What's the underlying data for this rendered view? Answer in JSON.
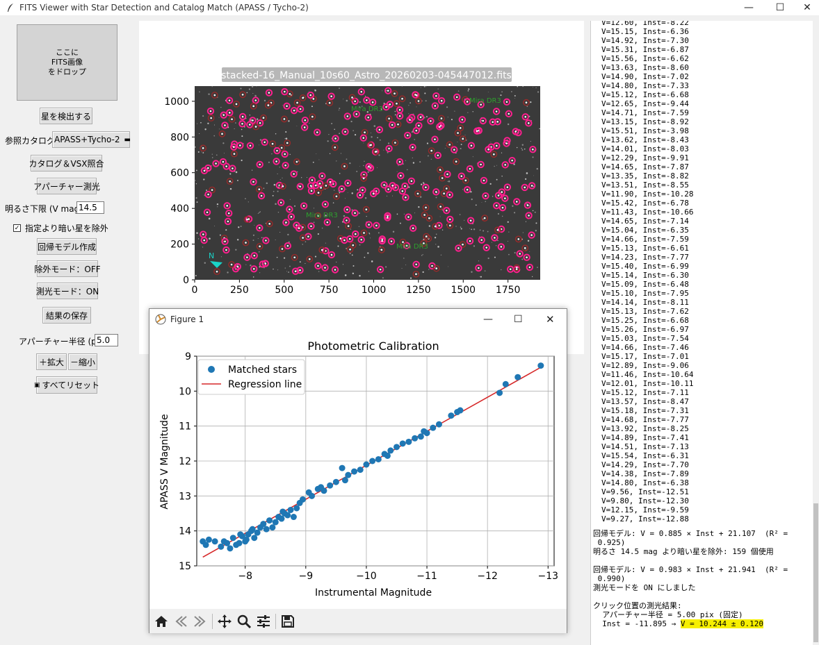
{
  "window": {
    "title": "FITS Viewer with Star Detection and Catalog Match (APASS / Tycho-2)",
    "min": "—",
    "max": "☐",
    "close": "✕"
  },
  "left": {
    "dropzone": [
      "ここに",
      "FITS画像",
      "をドロップ"
    ],
    "detect": "星を検出する",
    "catalog_label": "参照カタログ:",
    "catalog_value": "APASS+Tycho-2",
    "match": "カタログ＆VSX照合",
    "aperture_btn": "アパーチャー測光",
    "mag_label": "明るさ下限 (V mag):",
    "mag_value": "14.5",
    "exclude_faint": "指定より暗い星を除外",
    "regression": "回帰モデル作成",
    "exclude_mode": "除外モード：OFF",
    "phot_mode": "測光モード：ON",
    "save": "結果の保存",
    "radius_label": "アパーチャー半径 (pix):",
    "radius_value": "5.0",
    "zoom_in": "＋拡大",
    "zoom_out": "－縮小",
    "reset": "すべてリセット"
  },
  "image": {
    "filename": "stacked-16_Manual_10s60_Astro_20260203-045447012.fits",
    "xticks": [
      "0",
      "250",
      "500",
      "750",
      "1000",
      "1250",
      "1500",
      "1750"
    ],
    "yticks": [
      "0",
      "200",
      "400",
      "600",
      "800",
      "1000"
    ],
    "labels": [
      "Mira DR3",
      "Mira DR3",
      "Mira DR3",
      "Mira DR3"
    ],
    "north": "N"
  },
  "figure": {
    "window_title": "Figure 1",
    "legend_points": "Matched stars",
    "legend_line": "Regression line"
  },
  "chart_data": {
    "type": "scatter",
    "title": "Photometric Calibration",
    "xlabel": "Instrumental Magnitude",
    "ylabel": "APASS V Magnitude",
    "xlim": [
      -7.2,
      -13.1
    ],
    "ylim": [
      15,
      9
    ],
    "xticks": [
      -8,
      -9,
      -10,
      -11,
      -12,
      -13
    ],
    "yticks": [
      9,
      10,
      11,
      12,
      13,
      14,
      15
    ],
    "series": [
      {
        "name": "Matched stars",
        "color": "#1f77b4",
        "points": [
          [
            -7.3,
            14.3
          ],
          [
            -7.35,
            14.4
          ],
          [
            -7.4,
            14.25
          ],
          [
            -7.5,
            14.3
          ],
          [
            -7.6,
            14.45
          ],
          [
            -7.65,
            14.3
          ],
          [
            -7.7,
            14.35
          ],
          [
            -7.75,
            14.5
          ],
          [
            -7.8,
            14.2
          ],
          [
            -7.85,
            14.4
          ],
          [
            -7.9,
            14.35
          ],
          [
            -7.95,
            14.15
          ],
          [
            -8.0,
            14.3
          ],
          [
            -8.05,
            14.1
          ],
          [
            -8.1,
            14.0
          ],
          [
            -8.15,
            14.2
          ],
          [
            -8.2,
            14.05
          ],
          [
            -8.25,
            13.9
          ],
          [
            -8.3,
            13.8
          ],
          [
            -8.35,
            13.95
          ],
          [
            -8.4,
            13.7
          ],
          [
            -8.45,
            13.9
          ],
          [
            -8.5,
            13.75
          ],
          [
            -8.55,
            13.6
          ],
          [
            -8.6,
            13.65
          ],
          [
            -8.65,
            13.5
          ],
          [
            -8.7,
            13.55
          ],
          [
            -8.75,
            13.4
          ],
          [
            -8.8,
            13.6
          ],
          [
            -8.85,
            13.35
          ],
          [
            -8.9,
            13.2
          ],
          [
            -8.95,
            13.1
          ],
          [
            -9.05,
            12.9
          ],
          [
            -9.1,
            13.0
          ],
          [
            -9.2,
            12.8
          ],
          [
            -9.3,
            12.85
          ],
          [
            -9.4,
            12.7
          ],
          [
            -9.5,
            12.6
          ],
          [
            -9.6,
            12.2
          ],
          [
            -9.65,
            12.55
          ],
          [
            -9.7,
            12.4
          ],
          [
            -9.8,
            12.3
          ],
          [
            -9.9,
            12.25
          ],
          [
            -10.0,
            12.1
          ],
          [
            -10.1,
            12.0
          ],
          [
            -10.2,
            11.95
          ],
          [
            -10.3,
            11.8
          ],
          [
            -10.4,
            11.7
          ],
          [
            -10.5,
            11.6
          ],
          [
            -10.6,
            11.5
          ],
          [
            -10.7,
            11.45
          ],
          [
            -10.8,
            11.35
          ],
          [
            -10.9,
            11.3
          ],
          [
            -11.0,
            11.2
          ],
          [
            -11.1,
            11.05
          ],
          [
            -11.2,
            10.95
          ],
          [
            -11.4,
            10.7
          ],
          [
            -11.5,
            10.6
          ],
          [
            -11.55,
            10.55
          ],
          [
            -12.2,
            10.05
          ],
          [
            -12.3,
            9.8
          ],
          [
            -12.5,
            9.6
          ],
          [
            -12.88,
            9.27
          ],
          [
            -8.12,
            13.95
          ],
          [
            -8.02,
            14.25
          ],
          [
            -7.92,
            14.1
          ],
          [
            -8.62,
            13.45
          ],
          [
            -9.25,
            12.75
          ],
          [
            -10.35,
            11.85
          ],
          [
            -10.95,
            11.15
          ]
        ]
      }
    ],
    "regression": {
      "color": "#d62728",
      "x": [
        -7.3,
        -12.9
      ],
      "y": [
        14.75,
        9.3
      ]
    }
  },
  "console": {
    "lines": [
      "V=12.60, Inst=-8.22",
      "V=15.15, Inst=-6.36",
      "V=14.92, Inst=-7.30",
      "V=15.31, Inst=-6.87",
      "V=15.56, Inst=-6.62",
      "V=13.63, Inst=-8.60",
      "V=14.90, Inst=-7.02",
      "V=14.80, Inst=-7.33",
      "V=15.12, Inst=-6.68",
      "V=12.65, Inst=-9.44",
      "V=14.71, Inst=-7.59",
      "V=13.15, Inst=-8.92",
      "V=15.51, Inst=-3.98",
      "V=13.62, Inst=-8.43",
      "V=14.01, Inst=-8.03",
      "V=12.29, Inst=-9.91",
      "V=14.65, Inst=-7.87",
      "V=13.35, Inst=-8.82",
      "V=13.51, Inst=-8.55",
      "V=11.90, Inst=-10.28",
      "V=15.42, Inst=-6.78",
      "V=11.43, Inst=-10.66",
      "V=14.65, Inst=-7.14",
      "V=15.04, Inst=-6.35",
      "V=14.66, Inst=-7.59",
      "V=15.13, Inst=-6.61",
      "V=14.23, Inst=-7.77",
      "V=15.40, Inst=-6.99",
      "V=15.14, Inst=-6.30",
      "V=15.09, Inst=-6.48",
      "V=15.10, Inst=-7.95",
      "V=14.14, Inst=-8.11",
      "V=15.13, Inst=-7.62",
      "V=15.25, Inst=-6.68",
      "V=15.26, Inst=-6.97",
      "V=15.03, Inst=-7.54",
      "V=14.66, Inst=-7.46",
      "V=15.17, Inst=-7.01",
      "V=12.89, Inst=-9.06",
      "V=11.46, Inst=-10.64",
      "V=12.01, Inst=-10.11",
      "V=15.12, Inst=-7.11",
      "V=13.57, Inst=-8.47",
      "V=15.18, Inst=-7.31",
      "V=14.68, Inst=-7.77",
      "V=13.92, Inst=-8.25",
      "V=14.89, Inst=-7.41",
      "V=14.51, Inst=-7.13",
      "V=15.54, Inst=-6.31",
      "V=14.29, Inst=-7.70",
      "V=14.38, Inst=-7.89",
      "V=14.80, Inst=-6.38",
      "V=9.56, Inst=-12.51",
      "V=9.80, Inst=-12.30",
      "V=12.15, Inst=-9.59",
      "V=9.27, Inst=-12.88"
    ],
    "footer": [
      "回帰モデル: V = 0.885 × Inst + 21.107  (R² =",
      " 0.925)",
      "明るさ 14.5 mag より暗い星を除外: 159 個使用",
      "",
      "回帰モデル: V = 0.983 × Inst + 21.941  (R² =",
      " 0.990)",
      "測光モードを ON にしました",
      "",
      "クリック位置の測光結果:",
      "  アパーチャー半径 = 5.00 pix (固定)"
    ],
    "result_prefix": "  Inst = -11.895 → ",
    "result_value": "V = 10.244 ± 0.120"
  }
}
